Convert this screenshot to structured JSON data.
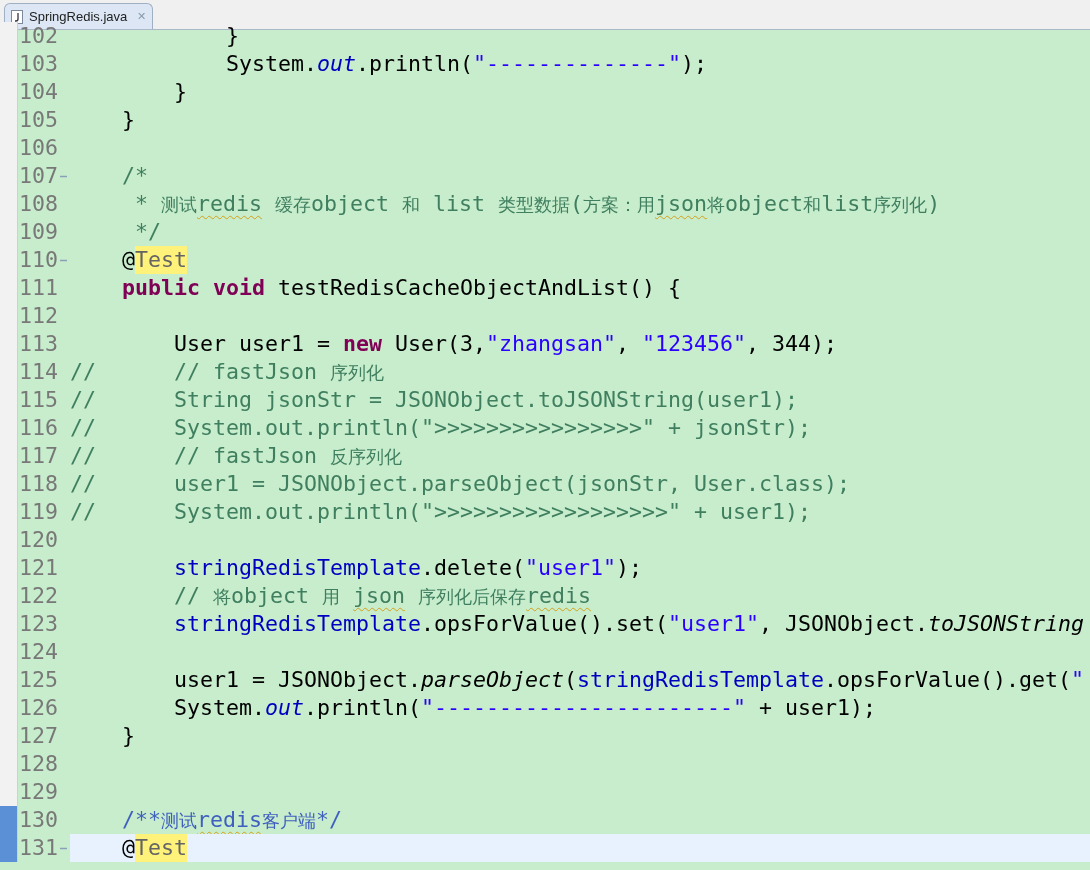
{
  "tab": {
    "title": "SpringRedis.java",
    "selected": true,
    "close": "✕"
  },
  "lines": [
    {
      "number": "102",
      "foldable": false,
      "current": false,
      "changed": false,
      "segments": [
        {
          "kind": "plain",
          "text": "            }"
        }
      ]
    },
    {
      "number": "103",
      "foldable": false,
      "current": false,
      "changed": false,
      "segments": [
        {
          "kind": "plain",
          "text": "            System."
        },
        {
          "kind": "static-field",
          "text": "out"
        },
        {
          "kind": "plain",
          "text": ".println("
        },
        {
          "kind": "string",
          "text": "\"--------------\""
        },
        {
          "kind": "plain",
          "text": ");"
        }
      ]
    },
    {
      "number": "104",
      "foldable": false,
      "current": false,
      "changed": false,
      "segments": [
        {
          "kind": "plain",
          "text": "        }"
        }
      ]
    },
    {
      "number": "105",
      "foldable": false,
      "current": false,
      "changed": false,
      "segments": [
        {
          "kind": "plain",
          "text": "    }"
        }
      ]
    },
    {
      "number": "106",
      "foldable": false,
      "current": false,
      "changed": false
    },
    {
      "number": "107",
      "foldable": true,
      "current": false,
      "changed": false,
      "segments": [
        {
          "kind": "comment",
          "text": "    /*"
        }
      ]
    },
    {
      "number": "108",
      "foldable": false,
      "current": false,
      "changed": false,
      "segments": [
        {
          "kind": "comment",
          "text": "     * 测试"
        },
        {
          "kind": "comment",
          "text": "redis",
          "flagged": true
        },
        {
          "kind": "comment",
          "text": " 缓存object 和 list 类型数据(方案：用"
        },
        {
          "kind": "comment",
          "text": "json",
          "flagged": true
        },
        {
          "kind": "comment",
          "text": "将object和list序列化)"
        }
      ]
    },
    {
      "number": "109",
      "foldable": false,
      "current": false,
      "changed": false,
      "segments": [
        {
          "kind": "comment",
          "text": "     */"
        }
      ]
    },
    {
      "number": "110",
      "foldable": true,
      "current": false,
      "changed": false,
      "segments": [
        {
          "kind": "plain",
          "text": "    @"
        },
        {
          "kind": "annotation",
          "text": "Test",
          "highlighted": true
        }
      ]
    },
    {
      "number": "111",
      "foldable": false,
      "current": false,
      "changed": false,
      "segments": [
        {
          "kind": "keyword",
          "text": "    public"
        },
        {
          "kind": "keyword",
          "text": " void"
        },
        {
          "kind": "plain",
          "text": " testRedisCacheObjectAndList() {"
        }
      ]
    },
    {
      "number": "112",
      "foldable": false,
      "current": false,
      "changed": false
    },
    {
      "number": "113",
      "foldable": false,
      "current": false,
      "changed": false,
      "segments": [
        {
          "kind": "plain",
          "text": "        User user1 = "
        },
        {
          "kind": "keyword",
          "text": "new"
        },
        {
          "kind": "plain",
          "text": " User(3,"
        },
        {
          "kind": "string",
          "text": "\"zhangsan\""
        },
        {
          "kind": "plain",
          "text": ", "
        },
        {
          "kind": "string",
          "text": "\"123456\""
        },
        {
          "kind": "plain",
          "text": ", 344);"
        }
      ]
    },
    {
      "number": "114",
      "foldable": false,
      "current": false,
      "changed": false,
      "segments": [
        {
          "kind": "comment",
          "text": "//      // fastJson 序列化"
        }
      ]
    },
    {
      "number": "115",
      "foldable": false,
      "current": false,
      "changed": false,
      "segments": [
        {
          "kind": "comment",
          "text": "//      String jsonStr = JSONObject.toJSONString(user1);"
        }
      ]
    },
    {
      "number": "116",
      "foldable": false,
      "current": false,
      "changed": false,
      "segments": [
        {
          "kind": "comment",
          "text": "//      System.out.println(\">>>>>>>>>>>>>>>>\" + jsonStr);"
        }
      ]
    },
    {
      "number": "117",
      "foldable": false,
      "current": false,
      "changed": false,
      "segments": [
        {
          "kind": "comment",
          "text": "//      // fastJson 反序列化"
        }
      ]
    },
    {
      "number": "118",
      "foldable": false,
      "current": false,
      "changed": false,
      "segments": [
        {
          "kind": "comment",
          "text": "//      user1 = JSONObject.parseObject(jsonStr, User.class);"
        }
      ]
    },
    {
      "number": "119",
      "foldable": false,
      "current": false,
      "changed": false,
      "segments": [
        {
          "kind": "comment",
          "text": "//      System.out.println(\">>>>>>>>>>>>>>>>>>\" + user1);"
        }
      ]
    },
    {
      "number": "120",
      "foldable": false,
      "current": false,
      "changed": false
    },
    {
      "number": "121",
      "foldable": false,
      "current": false,
      "changed": false,
      "segments": [
        {
          "kind": "field",
          "text": "        stringRedisTemplate"
        },
        {
          "kind": "plain",
          "text": ".delete("
        },
        {
          "kind": "string",
          "text": "\"user1\""
        },
        {
          "kind": "plain",
          "text": ");"
        }
      ]
    },
    {
      "number": "122",
      "foldable": false,
      "current": false,
      "changed": false,
      "segments": [
        {
          "kind": "comment",
          "text": "        // 将object 用 "
        },
        {
          "kind": "comment",
          "text": "json",
          "flagged": true
        },
        {
          "kind": "comment",
          "text": " 序列化后保存"
        },
        {
          "kind": "comment",
          "text": "redis",
          "flagged": true
        }
      ]
    },
    {
      "number": "123",
      "foldable": false,
      "current": false,
      "changed": false,
      "segments": [
        {
          "kind": "field",
          "text": "        stringRedisTemplate"
        },
        {
          "kind": "plain",
          "text": ".opsForValue().set("
        },
        {
          "kind": "string",
          "text": "\"user1\""
        },
        {
          "kind": "plain",
          "text": ", JSONObject."
        },
        {
          "kind": "static-method",
          "text": "toJSONString"
        }
      ]
    },
    {
      "number": "124",
      "foldable": false,
      "current": false,
      "changed": false
    },
    {
      "number": "125",
      "foldable": false,
      "current": false,
      "changed": false,
      "segments": [
        {
          "kind": "plain",
          "text": "        user1 = JSONObject."
        },
        {
          "kind": "static-method",
          "text": "parseObject"
        },
        {
          "kind": "plain",
          "text": "("
        },
        {
          "kind": "field",
          "text": "stringRedisTemplate"
        },
        {
          "kind": "plain",
          "text": ".opsForValue().get("
        },
        {
          "kind": "string",
          "text": "\""
        }
      ]
    },
    {
      "number": "126",
      "foldable": false,
      "current": false,
      "changed": false,
      "segments": [
        {
          "kind": "plain",
          "text": "        System."
        },
        {
          "kind": "static-field",
          "text": "out"
        },
        {
          "kind": "plain",
          "text": ".println("
        },
        {
          "kind": "string",
          "text": "\"-----------------------\""
        },
        {
          "kind": "plain",
          "text": " + user1);"
        }
      ]
    },
    {
      "number": "127",
      "foldable": false,
      "current": false,
      "changed": false,
      "segments": [
        {
          "kind": "plain",
          "text": "    }"
        }
      ]
    },
    {
      "number": "128",
      "foldable": false,
      "current": false,
      "changed": false
    },
    {
      "number": "129",
      "foldable": false,
      "current": false,
      "changed": false
    },
    {
      "number": "130",
      "foldable": false,
      "current": false,
      "changed": true,
      "segments": [
        {
          "kind": "javadoc",
          "text": "    /**测试"
        },
        {
          "kind": "javadoc",
          "text": "redis",
          "flagged": true
        },
        {
          "kind": "javadoc",
          "text": "客户端*/"
        }
      ]
    },
    {
      "number": "131",
      "foldable": true,
      "current": true,
      "changed": true,
      "segments": [
        {
          "kind": "plain",
          "text": "    @"
        },
        {
          "kind": "annotation",
          "text": "Test",
          "highlighted": true
        }
      ]
    }
  ]
}
